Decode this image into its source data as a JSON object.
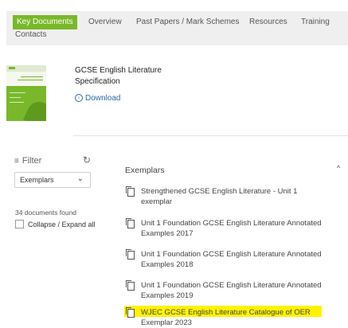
{
  "tabs": [
    {
      "label": "Key Documents",
      "active": true
    },
    {
      "label": "Overview"
    },
    {
      "label": "Past Papers / Mark Schemes"
    },
    {
      "label": "Resources"
    },
    {
      "label": "Training"
    },
    {
      "label": "Contacts"
    }
  ],
  "featured_document": {
    "title": "GCSE English Literature Specification",
    "download_label": "Download",
    "thumbnail_icon": "green-specification-cover"
  },
  "filter": {
    "label": "Filter",
    "refresh_icon": "refresh-icon",
    "select_value": "Exemplars",
    "documents_found": "34 documents found",
    "collapse_label": "Collapse / Expand all"
  },
  "group": {
    "title": "Exemplars",
    "items": [
      "Strengthened GCSE English Literature - Unit 1 exemplar",
      "Unit 1 Foundation GCSE English Literature Annotated Examples 2017",
      "Unit 1 Foundation GCSE English Literature Annotated Examples 2018",
      "Unit 1 Foundation GCSE English Literature Annotated Examples 2019",
      "WJEC GCSE English Literature Catalogue of OER Exemplar 2023"
    ]
  },
  "colors": {
    "accent": "#79b82a",
    "link": "#2d6aa8",
    "highlight": "#fff200"
  }
}
